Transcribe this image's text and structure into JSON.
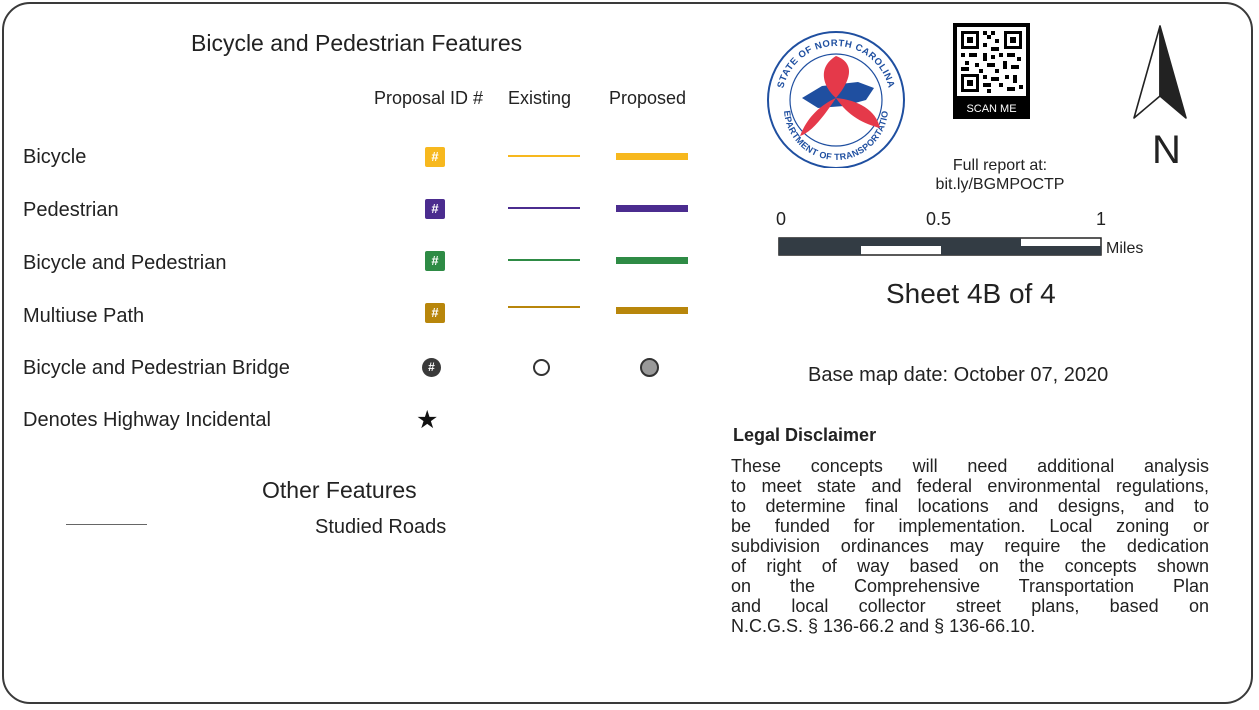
{
  "legend": {
    "title": "Bicycle and Pedestrian Features",
    "col_id": "Proposal ID #",
    "col_existing": "Existing",
    "col_proposed": "Proposed",
    "rows": [
      {
        "label": "Bicycle",
        "badge": "#",
        "color": "#F7B81E"
      },
      {
        "label": "Pedestrian",
        "badge": "#",
        "color": "#4B2C8F"
      },
      {
        "label": "Bicycle and Pedestrian",
        "badge": "#",
        "color": "#2E8B45"
      },
      {
        "label": "Multiuse Path",
        "badge": "#",
        "color": "#B8860B"
      }
    ],
    "bridge": {
      "label": "Bicycle and Pedestrian Bridge",
      "badge": "#"
    },
    "highway": {
      "label": "Denotes Highway Incidental",
      "glyph": "★"
    }
  },
  "other": {
    "title": "Other Features",
    "studied_roads": "Studied Roads"
  },
  "logo": {
    "text_top": "STATE OF NORTH CAROLINA",
    "text_bottom": "DEPARTMENT OF TRANSPORTATION",
    "icon": "ncdot-seal-icon"
  },
  "qr": {
    "label": "SCAN ME"
  },
  "north": {
    "letter": "N"
  },
  "report": {
    "line1": "Full report at:",
    "line2": "bit.ly/BGMPOCTP"
  },
  "scale": {
    "tick0": "0",
    "tick1": "0.5",
    "tick2": "1",
    "unit": "Miles"
  },
  "sheet": "Sheet 4B of 4",
  "base_map_date": "Base map date: October 07, 2020",
  "disclaimer": {
    "title": "Legal Disclaimer",
    "lines": [
      "These concepts will need additional analysis",
      "to meet state and federal environmental regulations,",
      "to determine final locations and designs, and to",
      "be funded for implementation. Local zoning or",
      "subdivision ordinances may require the dedication",
      "of right of way based on the concepts shown",
      "on the Comprehensive Transportation Plan",
      "and local collector street plans, based on",
      "N.C.G.S. § 136-66.2 and § 136-66.10."
    ]
  }
}
